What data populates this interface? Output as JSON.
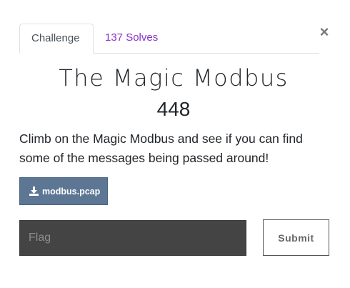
{
  "tabs": [
    {
      "label": "Challenge",
      "active": true
    },
    {
      "label": "137 Solves",
      "active": false
    }
  ],
  "close_label": "×",
  "challenge": {
    "name": "The Magic Modbus",
    "value": "448",
    "description": "Climb on the Magic Modbus and see if you can find some of the messages being passed around!"
  },
  "files": [
    {
      "name": "modbus.pcap",
      "icon": "download-icon"
    }
  ],
  "flag_form": {
    "input_value": "",
    "placeholder": "Flag",
    "submit_label": "Submit"
  },
  "colors": {
    "tab_link": "#8a32c9",
    "file_button": "#5c7694",
    "flag_input_bg": "#444444"
  }
}
